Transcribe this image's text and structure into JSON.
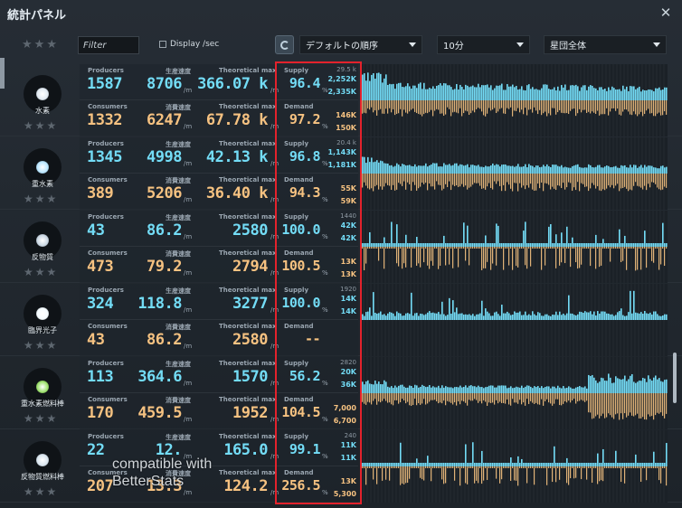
{
  "window": {
    "title": "統計パネル",
    "close_icon": "close-icon"
  },
  "toolbar": {
    "filter_placeholder": "Filter",
    "display_sec_label": "Display /sec",
    "sort_dropdown": "デフォルトの順序",
    "time_dropdown": "10分",
    "scope_dropdown": "星団全体"
  },
  "labels": {
    "producers": "Producers",
    "consumers": "Consumers",
    "production_rate": "生産速度",
    "consumption_rate": "消費速度",
    "theoretical_max": "Theoretical max",
    "supply": "Supply",
    "demand": "Demand",
    "per_min": "/m",
    "percent": "%"
  },
  "colors": {
    "supply": "#73dcf6",
    "demand": "#f6c281",
    "highlight": "#e3222c"
  },
  "items": [
    {
      "name": "水素",
      "icon": "hydrogen-icon",
      "core_color": "#dfe8f0",
      "producers": "1587",
      "prod_rate": "8706",
      "prod_max": "366.07 k",
      "consumers": "1332",
      "cons_rate": "6247",
      "cons_max": "67.78 k",
      "supply_pct": "96.4",
      "demand_pct": "97.2",
      "chart_max": "29.5 k",
      "supply_a": "2,252K",
      "supply_b": "2,335K",
      "demand_a": "146K",
      "demand_b": "150K",
      "supply_level": 0.42,
      "demand_level": 0.32,
      "pattern": "dense"
    },
    {
      "name": "重水素",
      "icon": "deuterium-icon",
      "core_color": "#b9e6ff",
      "producers": "1345",
      "prod_rate": "4998",
      "prod_max": "42.13 k",
      "consumers": "389",
      "cons_rate": "5206",
      "cons_max": "36.40 k",
      "supply_pct": "96.8",
      "demand_pct": "94.3",
      "chart_max": "20.4 k",
      "supply_a": "1,143K",
      "supply_b": "1,181K",
      "demand_a": "55K",
      "demand_b": "59K",
      "supply_level": 0.25,
      "demand_level": 0.35,
      "pattern": "dense"
    },
    {
      "name": "反物質",
      "icon": "antimatter-icon",
      "core_color": "#c9d6e2",
      "producers": "43",
      "prod_rate": "86.2",
      "prod_max": "2580",
      "consumers": "473",
      "cons_rate": "79.2",
      "cons_max": "2794",
      "supply_pct": "100.0",
      "demand_pct": "100.5",
      "chart_max": "1440",
      "supply_a": "42K",
      "supply_b": "42K",
      "demand_a": "13K",
      "demand_b": "13K",
      "supply_level": 0.12,
      "demand_level": 0.55,
      "pattern": "sparse"
    },
    {
      "name": "臨界光子",
      "icon": "critical-photon-icon",
      "core_color": "#f4fbff",
      "producers": "324",
      "prod_rate": "118.8",
      "prod_max": "3277",
      "consumers": "43",
      "cons_rate": "86.2",
      "cons_max": "2580",
      "supply_pct": "100.0",
      "demand_pct": "--",
      "chart_max": "1920",
      "supply_a": "14K",
      "supply_b": "14K",
      "demand_a": "",
      "demand_b": "",
      "supply_level": 0.22,
      "demand_level": 0.0,
      "pattern": "spiky"
    },
    {
      "name": "重水素燃料棒",
      "icon": "deuteron-fuel-rod-icon",
      "core_color": "#9be06a",
      "producers": "113",
      "prod_rate": "364.6",
      "prod_max": "1570",
      "consumers": "170",
      "cons_rate": "459.5",
      "cons_max": "1952",
      "supply_pct": "56.2",
      "demand_pct": "104.5",
      "chart_max": "2820",
      "supply_a": "20K",
      "supply_b": "36K",
      "demand_a": "7,000",
      "demand_b": "6,700",
      "supply_level": 0.2,
      "demand_level": 0.25,
      "pattern": "dense"
    },
    {
      "name": "反物質燃料棒",
      "icon": "antimatter-fuel-rod-icon",
      "core_color": "#d8e4ee",
      "producers": "22",
      "prod_rate": "12.",
      "prod_max": "165.0",
      "consumers": "207",
      "cons_rate": "13.3",
      "cons_max": "124.2",
      "supply_pct": "99.1",
      "demand_pct": "256.5",
      "chart_max": "240",
      "supply_a": "11K",
      "supply_b": "11K",
      "demand_a": "13K",
      "demand_b": "5,300",
      "supply_level": 0.35,
      "demand_level": 0.45,
      "pattern": "sparse"
    }
  ],
  "watermark": {
    "line1": "compatible with",
    "line2": "BetterStats"
  }
}
